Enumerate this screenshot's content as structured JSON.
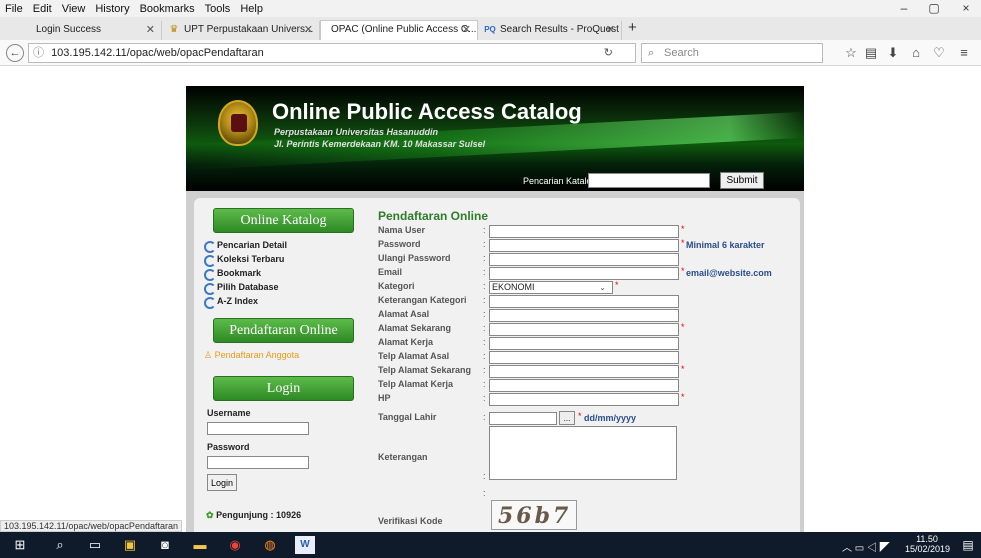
{
  "menubar": {
    "items": [
      "File",
      "Edit",
      "View",
      "History",
      "Bookmarks",
      "Tools",
      "Help"
    ]
  },
  "window_controls": {
    "minimize": "–",
    "restore": "▢",
    "close": "×"
  },
  "tabs": [
    {
      "label": "Login Success"
    },
    {
      "label": "UPT Perpustakaan Univers..."
    },
    {
      "label": "OPAC (Online Public Access C..."
    },
    {
      "label": "Search Results - ProQuest"
    }
  ],
  "new_tab": "+",
  "nav": {
    "url": "103.195.142.11/opac/web/opacPendaftaran",
    "search_placeholder": "Search"
  },
  "header": {
    "title": "Online Public Access Catalog",
    "subtitle1": "Perpustakaan Universitas Hasanuddin",
    "subtitle2": "Jl. Perintis Kemerdekaan KM. 10 Makassar Sulsel",
    "search_label": "Pencarian Katalog",
    "submit": "Submit"
  },
  "sidebar": {
    "katalog_title": "Online Katalog",
    "links": [
      "Pencarian Detail",
      "Koleksi Terbaru",
      "Bookmark",
      "Pilih Database",
      "A-Z Index"
    ],
    "pendaftaran_title": "Pendaftaran Online",
    "pendaftaran_link": "Pendaftaran Anggota",
    "login_title": "Login",
    "username_label": "Username",
    "password_label": "Password",
    "login_button": "Login",
    "visitors": "Pengunjung : 10926"
  },
  "form": {
    "title": "Pendaftaran Online",
    "nama_user": "Nama User",
    "password": "Password",
    "password_hint": "Minimal 6 karakter",
    "ulangi_password": "Ulangi Password",
    "email": "Email",
    "email_hint": "email@website.com",
    "kategori": "Kategori",
    "kategori_value": "EKONOMI",
    "keterangan_kategori": "Keterangan Kategori",
    "alamat_asal": "Alamat Asal",
    "alamat_sekarang": "Alamat Sekarang",
    "alamat_kerja": "Alamat Kerja",
    "telp_alamat_asal": "Telp Alamat Asal",
    "telp_alamat_sekarang": "Telp Alamat Sekarang",
    "telp_alamat_kerja": "Telp Alamat Kerja",
    "hp": "HP",
    "tanggal_lahir": "Tanggal Lahir",
    "date_button": "...",
    "date_hint": "dd/mm/yyyy",
    "keterangan": "Keterangan",
    "verifikasi": "Verifikasi Kode",
    "captcha_text": "56b7",
    "colon": ":",
    "required": "*"
  },
  "status_url": "103.195.142.11/opac/web/opacPendaftaran",
  "taskbar": {
    "time": "11.50",
    "date": "15/02/2019"
  }
}
